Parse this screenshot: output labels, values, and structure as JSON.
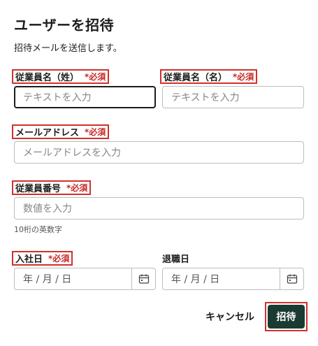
{
  "header": {
    "title": "ユーザーを招待",
    "subtitle": "招待メールを送信します。"
  },
  "fields": {
    "last_name": {
      "label": "従業員名（姓）",
      "required": "*必須",
      "placeholder": "テキストを入力"
    },
    "first_name": {
      "label": "従業員名（名）",
      "required": "*必須",
      "placeholder": "テキストを入力"
    },
    "email": {
      "label": "メールアドレス",
      "required": "*必須",
      "placeholder": "メールアドレスを入力"
    },
    "employee_number": {
      "label": "従業員番号",
      "required": "*必須",
      "placeholder": "数値を入力",
      "help": "10桁の英数字"
    },
    "join_date": {
      "label": "入社日",
      "required": "*必須",
      "placeholder": "年 / 月 / 日"
    },
    "leave_date": {
      "label": "退職日",
      "placeholder": "年 / 月 / 日"
    }
  },
  "actions": {
    "cancel_label": "キャンセル",
    "invite_label": "招待"
  },
  "icons": {
    "date_picker": "calendar-icon"
  },
  "colors": {
    "primary_button": "#1b3a32",
    "required": "#c62828",
    "highlight": "#d0312d"
  }
}
